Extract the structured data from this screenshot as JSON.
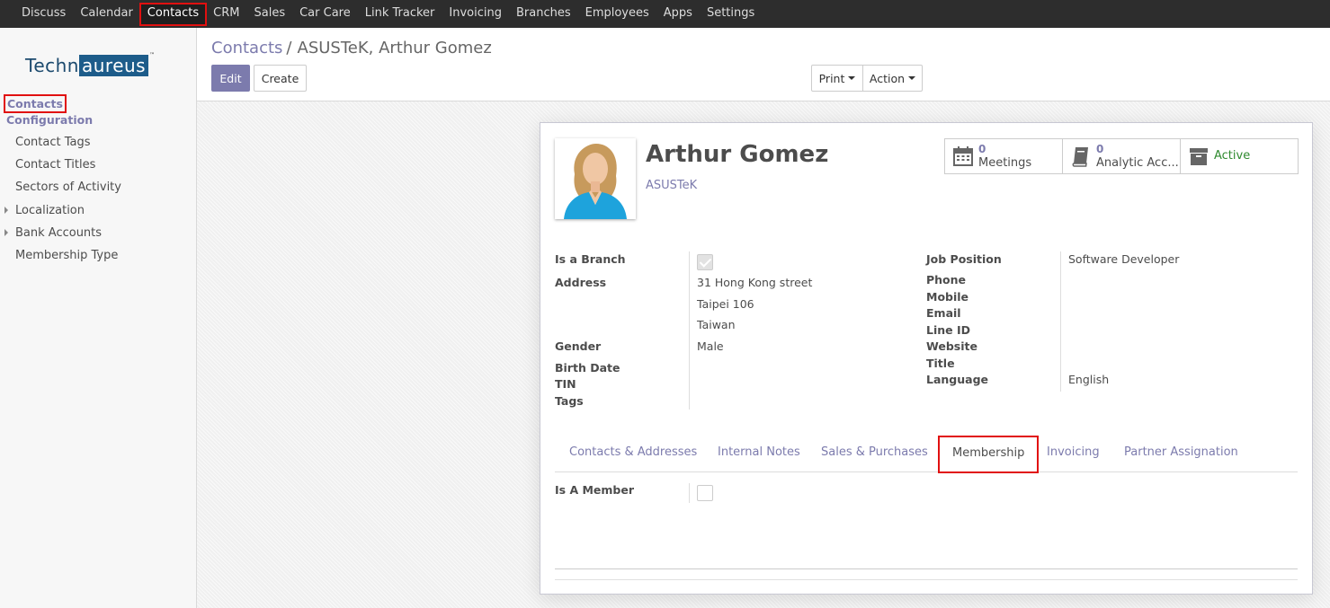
{
  "topbar": {
    "menu": [
      "Discuss",
      "Calendar",
      "Contacts",
      "CRM",
      "Sales",
      "Car Care",
      "Link Tracker",
      "Invoicing",
      "Branches",
      "Employees",
      "Apps",
      "Settings"
    ],
    "active": "Contacts"
  },
  "sidebar": {
    "logo_part1": "Techn",
    "logo_part2": "aureus",
    "logo_tm": "™",
    "section_contacts": "Contacts",
    "section_configuration": "Configuration",
    "items": [
      "Contact Tags",
      "Contact Titles",
      "Sectors of Activity",
      "Localization",
      "Bank Accounts",
      "Membership Type"
    ]
  },
  "control_panel": {
    "breadcrumb_root": "Contacts",
    "breadcrumb_sep": "/",
    "breadcrumb_current": "ASUSTeK, Arthur Gomez",
    "edit_label": "Edit",
    "create_label": "Create",
    "print_label": "Print",
    "action_label": "Action"
  },
  "record": {
    "name": "Arthur Gomez",
    "company": "ASUSTeK",
    "smart_buttons": {
      "meetings_count": "0",
      "meetings_label": "Meetings",
      "analytic_count": "0",
      "analytic_label": "Analytic Acc...",
      "active_label": "Active"
    },
    "left_fields": {
      "is_branch_label": "Is a Branch",
      "is_branch_checked": true,
      "address_label": "Address",
      "street": "31 Hong Kong street",
      "city": "Taipei 106",
      "country": "Taiwan",
      "gender_label": "Gender",
      "gender": "Male",
      "birth_date_label": "Birth Date",
      "tin_label": "TIN",
      "tags_label": "Tags"
    },
    "right_fields": {
      "job_position_label": "Job Position",
      "job_position": "Software Developer",
      "phone_label": "Phone",
      "mobile_label": "Mobile",
      "email_label": "Email",
      "line_id_label": "Line ID",
      "website_label": "Website",
      "title_label": "Title",
      "language_label": "Language",
      "language": "English"
    },
    "tabs": [
      "Contacts & Addresses",
      "Internal Notes",
      "Sales & Purchases",
      "Membership",
      "Invoicing",
      "Partner Assignation"
    ],
    "active_tab": "Membership",
    "membership": {
      "is_member_label": "Is A Member",
      "is_member_checked": false
    }
  },
  "colors": {
    "brand": "#7c7bad",
    "highlight": "#e11010",
    "active_status": "#2f8a2f"
  }
}
